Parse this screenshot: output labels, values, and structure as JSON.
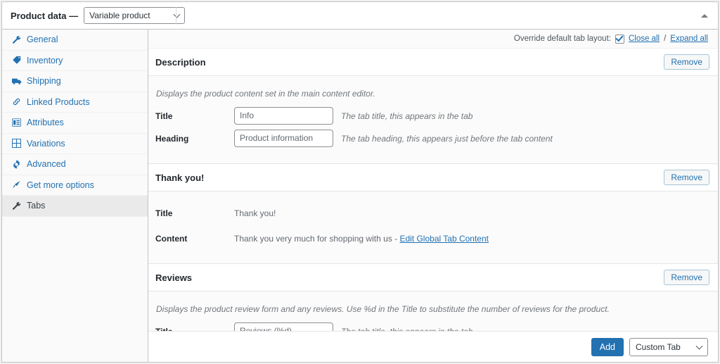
{
  "header": {
    "title": "Product data —",
    "product_type": "Variable product",
    "collapse_icon": "caret-up-icon"
  },
  "sidebar": {
    "items": [
      {
        "label": "General",
        "icon": "wrench-icon",
        "active": false
      },
      {
        "label": "Inventory",
        "icon": "tag-icon",
        "active": false
      },
      {
        "label": "Shipping",
        "icon": "truck-icon",
        "active": false
      },
      {
        "label": "Linked Products",
        "icon": "link-icon",
        "active": false
      },
      {
        "label": "Attributes",
        "icon": "list-icon",
        "active": false
      },
      {
        "label": "Variations",
        "icon": "grid-icon",
        "active": false
      },
      {
        "label": "Advanced",
        "icon": "gear-icon",
        "active": false
      },
      {
        "label": "Get more options",
        "icon": "megaphone-icon",
        "active": false
      },
      {
        "label": "Tabs",
        "icon": "wrench-icon",
        "active": true
      }
    ]
  },
  "override_bar": {
    "label": "Override default tab layout:",
    "checked": true,
    "close_all": "Close all",
    "separator": "/",
    "expand_all": "Expand all"
  },
  "tabs": [
    {
      "title": "Description",
      "remove_label": "Remove",
      "description": "Displays the product content set in the main content editor.",
      "fields": [
        {
          "kind": "input",
          "label": "Title",
          "value": "Info",
          "hint": "The tab title, this appears in the tab"
        },
        {
          "kind": "input",
          "label": "Heading",
          "value": "Product information",
          "hint": "The tab heading, this appears just before the tab content"
        }
      ]
    },
    {
      "title": "Thank you!",
      "remove_label": "Remove",
      "description": "",
      "fields": [
        {
          "kind": "static",
          "label": "Title",
          "value": "Thank you!"
        },
        {
          "kind": "static-link",
          "label": "Content",
          "value": "Thank you very much for shopping with us - ",
          "link_text": "Edit Global Tab Content"
        }
      ]
    },
    {
      "title": "Reviews",
      "remove_label": "Remove",
      "description": "Displays the product review form and any reviews. Use %d in the Title to substitute the number of reviews for the product.",
      "fields": [
        {
          "kind": "input",
          "label": "Title",
          "value": "Reviews (%d)",
          "hint": "The tab title, this appears in the tab"
        }
      ]
    }
  ],
  "footer": {
    "add_label": "Add",
    "tab_type": "Custom Tab"
  },
  "colors": {
    "accent": "#2271b1",
    "panel_bg": "#fbfbfb",
    "border": "#c3c4c7"
  }
}
